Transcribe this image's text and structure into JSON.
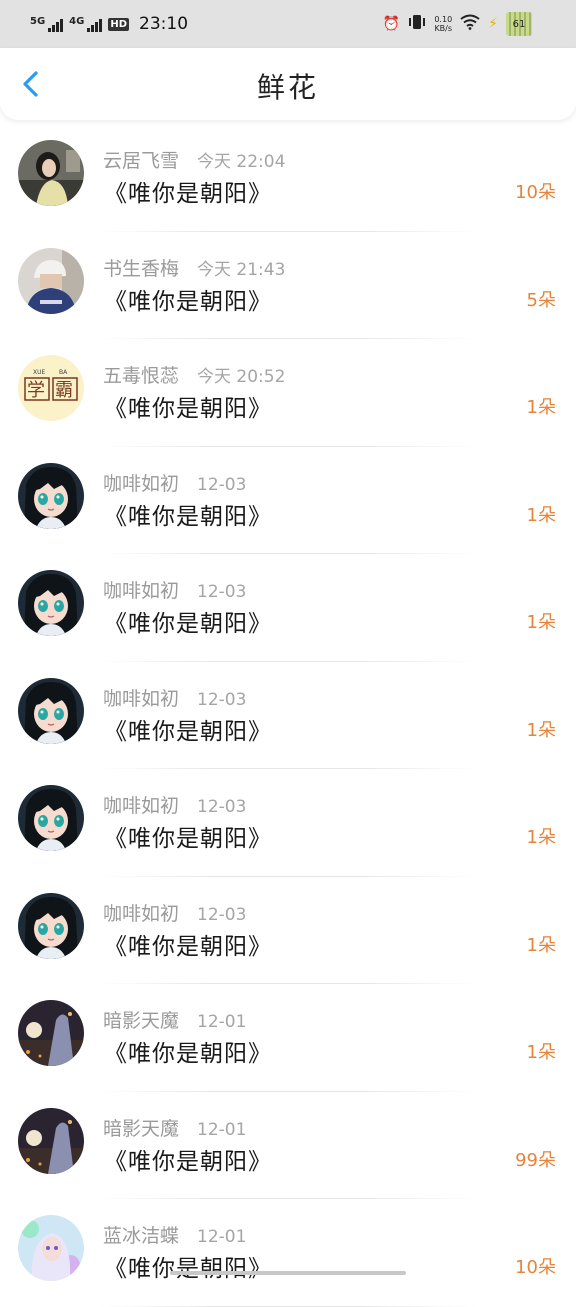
{
  "status_bar": {
    "signal1": "5G",
    "signal2": "4G",
    "hd": "HD",
    "time": "23:10",
    "speed_value": "0.10",
    "speed_unit": "KB/s",
    "battery": "61"
  },
  "header": {
    "title": "鲜花"
  },
  "colors": {
    "accent": "#2b9cf2",
    "count": "#e6843a"
  },
  "records": [
    {
      "name": "云居飞雪",
      "date": "今天 22:04",
      "book": "《唯你是朝阳》",
      "count": "10朵",
      "avatar": "photo-girl"
    },
    {
      "name": "书生香梅",
      "date": "今天 21:43",
      "book": "《唯你是朝阳》",
      "count": "5朵",
      "avatar": "photo-boy-cap"
    },
    {
      "name": "五毒恨蕊",
      "date": "今天 20:52",
      "book": "《唯你是朝阳》",
      "count": "1朵",
      "avatar": "xueba",
      "avatar_text_pinyin_1": "XUE",
      "avatar_text_pinyin_2": "BA",
      "avatar_text_1": "学",
      "avatar_text_2": "霸"
    },
    {
      "name": "咖啡如初",
      "date": "12-03",
      "book": "《唯你是朝阳》",
      "count": "1朵",
      "avatar": "anime-girl"
    },
    {
      "name": "咖啡如初",
      "date": "12-03",
      "book": "《唯你是朝阳》",
      "count": "1朵",
      "avatar": "anime-girl"
    },
    {
      "name": "咖啡如初",
      "date": "12-03",
      "book": "《唯你是朝阳》",
      "count": "1朵",
      "avatar": "anime-girl"
    },
    {
      "name": "咖啡如初",
      "date": "12-03",
      "book": "《唯你是朝阳》",
      "count": "1朵",
      "avatar": "anime-girl"
    },
    {
      "name": "咖啡如初",
      "date": "12-03",
      "book": "《唯你是朝阳》",
      "count": "1朵",
      "avatar": "anime-girl"
    },
    {
      "name": "暗影天魔",
      "date": "12-01",
      "book": "《唯你是朝阳》",
      "count": "1朵",
      "avatar": "night-moon"
    },
    {
      "name": "暗影天魔",
      "date": "12-01",
      "book": "《唯你是朝阳》",
      "count": "99朵",
      "avatar": "night-moon"
    },
    {
      "name": "蓝冰洁蝶",
      "date": "12-01",
      "book": "《唯你是朝阳》",
      "count": "10朵",
      "avatar": "fantasy-girl"
    }
  ]
}
